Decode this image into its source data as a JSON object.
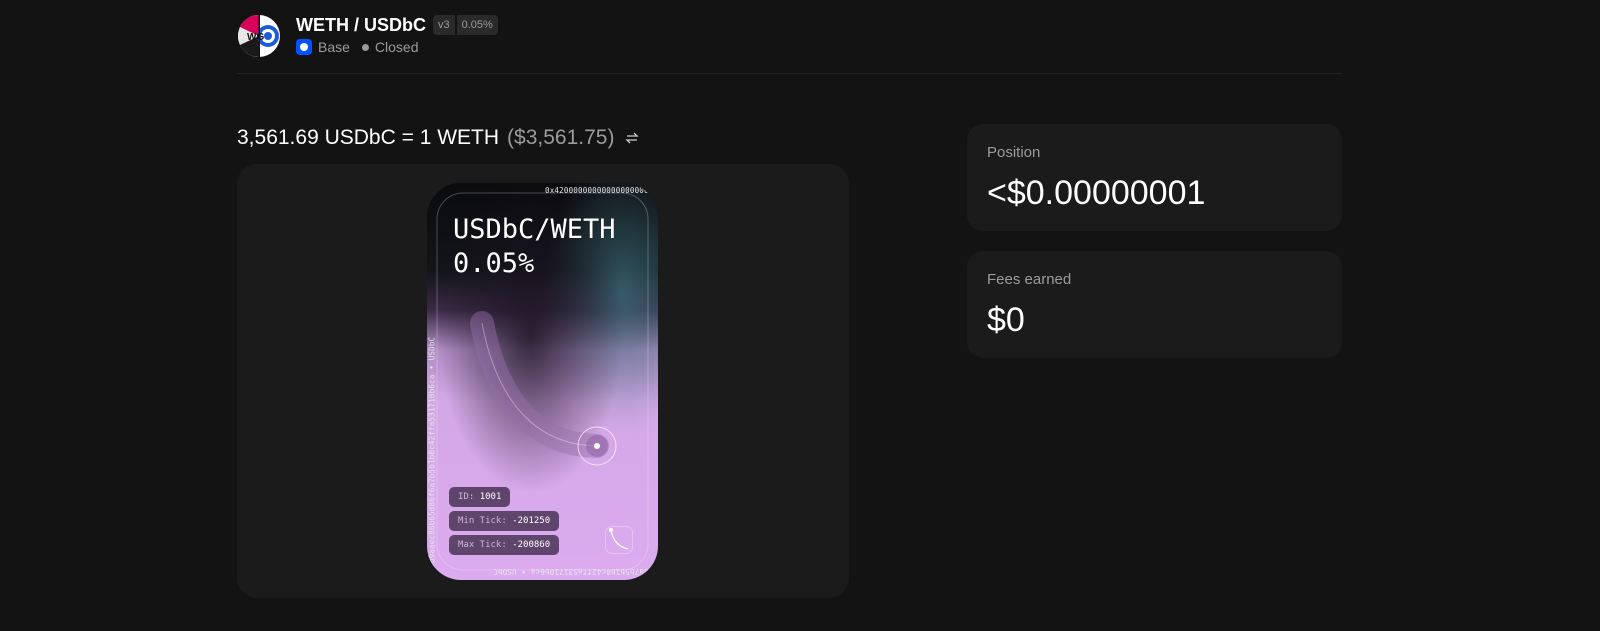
{
  "header": {
    "pair_name": "WETH / USDbC",
    "version_badge": "v3",
    "fee_badge": "0.05%",
    "chain_name": "Base",
    "status": "Closed",
    "logo_text": "WG"
  },
  "price": {
    "rate_text": "3,561.69 USDbC = 1 WETH",
    "usd_text": "($3,561.75)",
    "swap_icon": "arrows-left-right-icon"
  },
  "nft": {
    "title": "USDbC/WETH",
    "fee": "0.05%",
    "edge_top": "0x4200000000000000000000000000000000000006 • WETH",
    "edge_left": "0xd9aaec86b65d86f6a7b5b1b0c42ffa531710b6ca • USDbC",
    "id_key": "ID:",
    "id_value": "1001",
    "min_tick_key": "Min Tick:",
    "min_tick_value": "-201250",
    "max_tick_key": "Max Tick:",
    "max_tick_value": "-200860"
  },
  "stats": {
    "position_label": "Position",
    "position_value": "<$0.00000001",
    "fees_label": "Fees earned",
    "fees_value": "$0"
  },
  "colors": {
    "background": "#131313",
    "panel": "#1b1b1b",
    "muted_text": "#9b9b9b",
    "nft_pink": "#d9a7ea",
    "base_blue": "#0052ff"
  }
}
